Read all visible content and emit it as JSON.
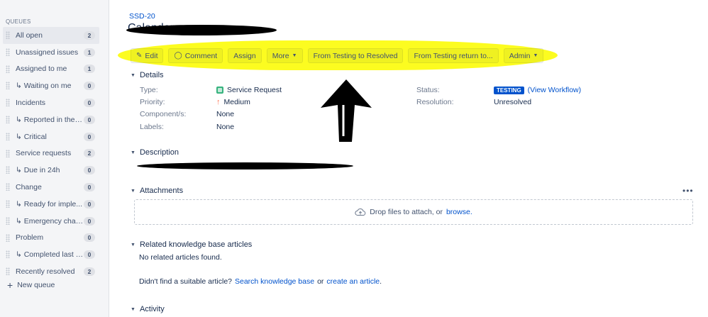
{
  "sidebar": {
    "heading": "QUEUES",
    "queues": [
      {
        "label": "All open",
        "count": "2"
      },
      {
        "label": "Unassigned issues",
        "count": "1"
      },
      {
        "label": "Assigned to me",
        "count": "1"
      },
      {
        "label": "↳ Waiting on me",
        "count": "0"
      },
      {
        "label": "Incidents",
        "count": "0"
      },
      {
        "label": "↳ Reported in the l...",
        "count": "0"
      },
      {
        "label": "↳ Critical",
        "count": "0"
      },
      {
        "label": "Service requests",
        "count": "2"
      },
      {
        "label": "↳ Due in 24h",
        "count": "0"
      },
      {
        "label": "Change",
        "count": "0"
      },
      {
        "label": "↳ Ready for imple...",
        "count": "0"
      },
      {
        "label": "↳ Emergency chan...",
        "count": "0"
      },
      {
        "label": "Problem",
        "count": "0"
      },
      {
        "label": "↳ Completed last 3...",
        "count": "0"
      },
      {
        "label": "Recently resolved",
        "count": "2"
      }
    ],
    "new_queue": "New queue"
  },
  "issue": {
    "key": "SSD-20",
    "title": "Calendar"
  },
  "toolbar": {
    "edit": "Edit",
    "comment": "Comment",
    "assign": "Assign",
    "more": "More",
    "to_resolved": "From Testing to Resolved",
    "return_to": "From Testing return to...",
    "admin": "Admin"
  },
  "details": {
    "heading": "Details",
    "type_label": "Type:",
    "type_value": "Service Request",
    "priority_label": "Priority:",
    "priority_value": "Medium",
    "components_label": "Component/s:",
    "components_value": "None",
    "labels_label": "Labels:",
    "labels_value": "None",
    "status_label": "Status:",
    "status_value": "TESTING",
    "view_workflow": "(View Workflow)",
    "resolution_label": "Resolution:",
    "resolution_value": "Unresolved"
  },
  "description": {
    "heading": "Description"
  },
  "attachments": {
    "heading": "Attachments",
    "drop_text": "Drop files to attach, or",
    "browse": "browse."
  },
  "kb": {
    "heading": "Related knowledge base articles",
    "none_found": "No related articles found.",
    "question": "Didn't find a suitable article?",
    "search": "Search knowledge base",
    "or": "or",
    "create": "create an article",
    "period": "."
  },
  "activity": {
    "heading": "Activity"
  },
  "colors": {
    "accent": "#0052cc",
    "highlight": "#fcfc20",
    "status": "#0052cc"
  }
}
